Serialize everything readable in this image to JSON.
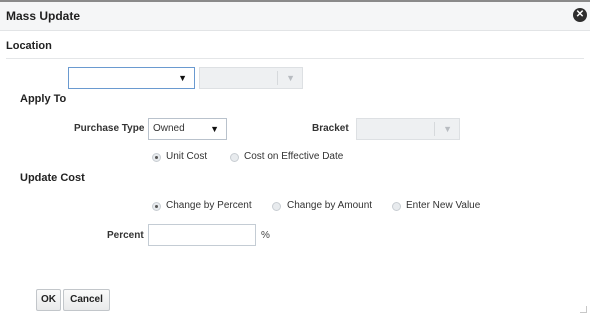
{
  "dialog": {
    "title": "Mass Update",
    "close_icon": "x-circle-icon"
  },
  "location": {
    "section_title": "Location",
    "primary_select_value": "",
    "secondary_select_value": ""
  },
  "apply_to": {
    "section_title": "Apply To",
    "purchase_type_label": "Purchase Type",
    "purchase_type_value": "Owned",
    "bracket_label": "Bracket",
    "bracket_value": "",
    "options": [
      {
        "label": "Unit Cost",
        "checked": true
      },
      {
        "label": "Cost on Effective Date",
        "checked": false
      }
    ]
  },
  "update_cost": {
    "section_title": "Update Cost",
    "options": [
      {
        "label": "Change by Percent",
        "checked": true
      },
      {
        "label": "Change by Amount",
        "checked": false
      },
      {
        "label": "Enter New Value",
        "checked": false
      }
    ],
    "percent_label": "Percent",
    "percent_value": "",
    "percent_unit": "%"
  },
  "footer": {
    "ok_label": "OK",
    "cancel_label": "Cancel"
  },
  "icons": {
    "dropdown": "triangle-down-icon"
  }
}
